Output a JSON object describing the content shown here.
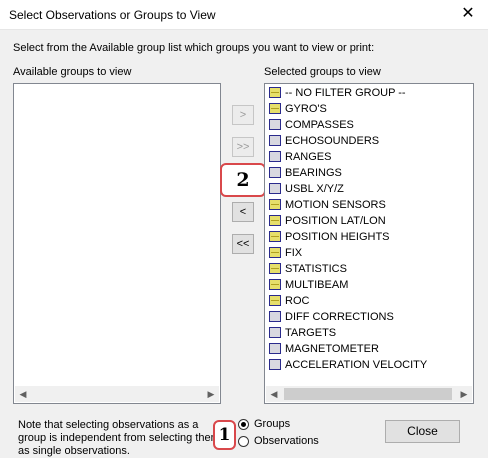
{
  "window": {
    "title": "Select Observations or Groups to View",
    "close_glyph": "✕"
  },
  "instruction": "Select from the Available group list which groups you want to view or print:",
  "available": {
    "label": "Available groups to view"
  },
  "selected": {
    "label": "Selected groups to view",
    "items": [
      {
        "label": "-- NO FILTER GROUP --",
        "icon": "yellow-group-icon"
      },
      {
        "label": "GYRO'S",
        "icon": "yellow-group-icon"
      },
      {
        "label": "COMPASSES",
        "icon": "grey-group-icon"
      },
      {
        "label": "ECHOSOUNDERS",
        "icon": "grey-group-icon"
      },
      {
        "label": "RANGES",
        "icon": "grey-group-icon"
      },
      {
        "label": "BEARINGS",
        "icon": "grey-group-icon"
      },
      {
        "label": "USBL X/Y/Z",
        "icon": "grey-group-icon"
      },
      {
        "label": "MOTION SENSORS",
        "icon": "yellow-group-icon"
      },
      {
        "label": "POSITION LAT/LON",
        "icon": "yellow-group-icon"
      },
      {
        "label": "POSITION HEIGHTS",
        "icon": "yellow-group-icon"
      },
      {
        "label": "FIX",
        "icon": "yellow-group-icon"
      },
      {
        "label": "STATISTICS",
        "icon": "yellow-group-icon"
      },
      {
        "label": "MULTIBEAM",
        "icon": "yellow-group-icon"
      },
      {
        "label": "ROC",
        "icon": "yellow-group-icon"
      },
      {
        "label": "DIFF CORRECTIONS",
        "icon": "grey-group-icon"
      },
      {
        "label": "TARGETS",
        "icon": "grey-group-icon"
      },
      {
        "label": "MAGNETOMETER",
        "icon": "grey-group-icon"
      },
      {
        "label": "ACCELERATION VELOCITY",
        "icon": "grey-group-icon"
      }
    ]
  },
  "move_buttons": {
    "add": ">",
    "add_all": ">>",
    "remove": "<",
    "remove_all": "<<"
  },
  "scroll": {
    "left": "◀",
    "right": "▶"
  },
  "callouts": {
    "one": "1",
    "two": "2"
  },
  "note": "Note that selecting observations as a group is independent from selecting them as single observations.",
  "mode": {
    "options": [
      "Groups",
      "Observations"
    ],
    "selected": "Groups"
  },
  "close_button": "Close",
  "colors": {
    "callout_border": "#d9484b",
    "icon_on": "#e6df6a",
    "icon_off": "#d8d8e0"
  }
}
